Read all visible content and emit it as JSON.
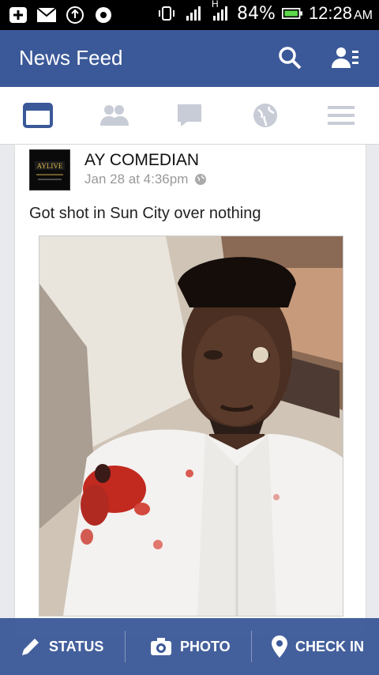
{
  "status_bar": {
    "battery": "84%",
    "time": "12:28",
    "ampm": "AM",
    "network_label": "H"
  },
  "header": {
    "title": "News Feed"
  },
  "post": {
    "author": "AY COMEDIAN",
    "timestamp": "Jan 28 at 4:36pm",
    "text": "Got shot in Sun City over nothing",
    "avatar_caption": "AYLIVE"
  },
  "actions": {
    "status": "STATUS",
    "photo": "PHOTO",
    "checkin": "CHECK IN"
  },
  "colors": {
    "brand": "#3b5998",
    "tab_active": "#3b5998",
    "tab_inactive": "#c7ccd6"
  }
}
